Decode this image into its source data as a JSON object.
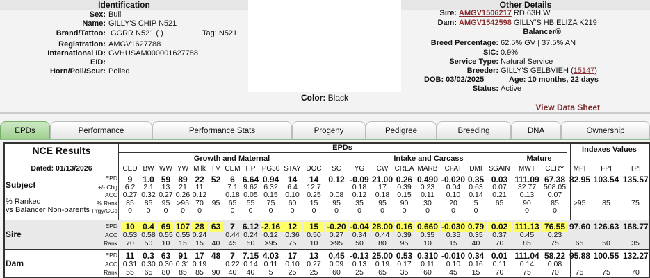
{
  "identification": {
    "header": "Identification",
    "rows": [
      {
        "label": "Sex:",
        "value": "Bull"
      },
      {
        "label": "Name:",
        "value": "GILLY'S CHIP N521"
      },
      {
        "label": "Brand/Tattoo:",
        "value": "GGRR N521 ( )"
      },
      {
        "label": "Registration:",
        "value": "AMGV1627788"
      },
      {
        "label": "International ID:",
        "value": "GVHUSAM000001627788"
      },
      {
        "label": "EID:",
        "value": ""
      },
      {
        "label": "Horn/Poll/Scur:",
        "value": "Polled"
      }
    ],
    "tag_label": "Tag:",
    "tag_value": "N521",
    "color_label": "Color:",
    "color_value": "Black"
  },
  "other": {
    "header": "Other Details",
    "sire_label": "Sire:",
    "sire_id": "AMGV1506217",
    "sire_name": "RD 63H W",
    "dam_label": "Dam:",
    "dam_id": "AMGV1542598",
    "dam_name": "GILLY'S HB ELIZA K219",
    "breed_name": "Balancer®",
    "breed_pct_label": "Breed Percentage:",
    "breed_pct": "62.5% GV | 37.5% AN",
    "sic_label": "SIC:",
    "sic": "0.9%",
    "service_label": "Service Type:",
    "service": "Natural Service",
    "breeder_label": "Breeder:",
    "breeder": "GILLY'S GELBVIEH (",
    "breeder_id": "15147",
    "breeder_close": ")",
    "dob": "DOB: 03/02/2025",
    "age": "Age: 10 months, 22 days",
    "status_label": "Status:",
    "status": "Active",
    "view_data_sheet": "View Data Sheet"
  },
  "tabs": [
    "EPDs",
    "Performance",
    "Performance Stats",
    "Progeny",
    "Pedigree",
    "Breeding",
    "DNA",
    "Ownership"
  ],
  "table": {
    "nce_title": "NCE Results",
    "dated": "Dated: 01/13/2026",
    "epds_header": "EPDs",
    "indexes_header": "Indexes Values",
    "groups": [
      "Growth and Maternal",
      "Intake and Carcass",
      "Mature"
    ],
    "cols": [
      "CED",
      "BW",
      "WW",
      "YW",
      "Milk",
      "TM",
      "CEM",
      "HP",
      "PG30",
      "STAY",
      "DOC",
      "SC",
      "YG",
      "CW",
      "CREA",
      "MARB",
      "CFAT",
      "DMI",
      "$GAIN",
      "MWT",
      "CERY",
      "MPI",
      "FPI",
      "TPI"
    ],
    "subject_label": "Subject",
    "pct_ranked": "% Ranked",
    "vs_balancer": "vs Balancer Non-parents",
    "subject_sub": [
      "EPD",
      "+/- Chg",
      "ACC",
      "% Rank",
      "Prgy/CGs"
    ],
    "sire_label": "Sire",
    "dam_label": "Dam",
    "parent_sub": [
      "EPD",
      "ACC",
      "Rank"
    ],
    "subject": {
      "epd": [
        "9",
        "1.0",
        "59",
        "89",
        "22",
        "52",
        "6",
        "6.64",
        "0.94",
        "14",
        "14",
        "0.12",
        "-0.09",
        "21.00",
        "0.26",
        "0.490",
        "-0.020",
        "0.35",
        "0.03",
        "111.09",
        "67.38",
        "82.95",
        "103.54",
        "135.57"
      ],
      "chg": [
        "6.2",
        "2.1",
        "13",
        "21",
        "11",
        "",
        "7.1",
        "9.62",
        "6.32",
        "6.4",
        "12.7",
        "",
        "0.18",
        "17",
        "0.39",
        "0.23",
        "0.04",
        "0.63",
        "0.07",
        "32.77",
        "508.05",
        "",
        "",
        ""
      ],
      "acc": [
        "0.27",
        "0.32",
        "0.27",
        "0.26",
        "0.12",
        "",
        "0.18",
        "0.05",
        "0.15",
        "0.10",
        "0.25",
        "0.08",
        "0.12",
        "0.18",
        "0.15",
        "0.11",
        "0.10",
        "0.14",
        "0.21",
        "0.13",
        "0.07",
        "",
        "",
        ""
      ],
      "rank": [
        "85",
        "85",
        "95",
        ">95",
        "70",
        "95",
        "65",
        "55",
        "75",
        "60",
        "15",
        "95",
        "35",
        "95",
        "90",
        "30",
        "20",
        "5",
        "65",
        "90",
        "85",
        ">95",
        "85",
        "75"
      ],
      "prgy": [
        "0",
        "0",
        "0",
        "0",
        "0",
        "",
        "0",
        "0",
        "0",
        "0",
        "0",
        "0",
        "0",
        "0",
        "0",
        "0",
        "0",
        "0",
        "",
        "0",
        "0",
        "",
        "",
        ""
      ]
    },
    "sire": {
      "epd": [
        "10",
        "0.4",
        "69",
        "107",
        "28",
        "63",
        "7",
        "6.12",
        "-2.16",
        "12",
        "15",
        "-0.20",
        "-0.04",
        "28.00",
        "0.16",
        "0.660",
        "-0.030",
        "0.79",
        "0.02",
        "111.13",
        "76.55",
        "97.60",
        "126.63",
        "168.77"
      ],
      "acc": [
        "0.53",
        "0.58",
        "0.55",
        "0.55",
        "0.24",
        "",
        "0.44",
        "0.24",
        "0.12",
        "0.36",
        "0.50",
        "0.27",
        "0.34",
        "0.44",
        "0.39",
        "0.35",
        "0.35",
        "0.35",
        "0.37",
        "0.45",
        "0.23",
        "",
        "",
        ""
      ],
      "rank": [
        "70",
        "50",
        "10",
        "15",
        "15",
        "40",
        "45",
        "50",
        ">95",
        "75",
        "10",
        ">95",
        "50",
        "80",
        "95",
        "10",
        "15",
        "40",
        "70",
        "85",
        "75",
        "65",
        "50",
        "35"
      ]
    },
    "dam": {
      "epd": [
        "11",
        "0.3",
        "63",
        "91",
        "17",
        "48",
        "7",
        "7.15",
        "4.03",
        "17",
        "13",
        "0.45",
        "-0.13",
        "25.00",
        "0.53",
        "0.310",
        "-0.010",
        "0.34",
        "0.01",
        "111.04",
        "58.22",
        "95.88",
        "100.55",
        "132.27"
      ],
      "acc": [
        "0.31",
        "0.30",
        "0.30",
        "0.31",
        "0.19",
        "",
        "0.22",
        "0.14",
        "0.11",
        "0.10",
        "0.27",
        "0.09",
        "0.13",
        "0.19",
        "0.17",
        "0.11",
        "0.10",
        "0.16",
        "0.11",
        "0.14",
        "0.08",
        "",
        "",
        ""
      ],
      "rank": [
        "55",
        "65",
        "80",
        "85",
        "85",
        "90",
        "40",
        "40",
        "5",
        "25",
        "25",
        "60",
        "25",
        "65",
        "35",
        "60",
        "45",
        "15",
        "70",
        "75",
        "70",
        "75",
        "75",
        "70"
      ]
    },
    "sire_highlight": [
      1,
      1,
      1,
      1,
      1,
      1,
      0,
      0,
      1,
      1,
      1,
      1,
      1,
      1,
      1,
      1,
      1,
      1,
      1,
      1,
      1,
      0,
      0,
      0
    ]
  },
  "colors": {
    "highlight": "#ffff66",
    "link": "#8a2f2f",
    "tab_active": "#9fd08f"
  }
}
